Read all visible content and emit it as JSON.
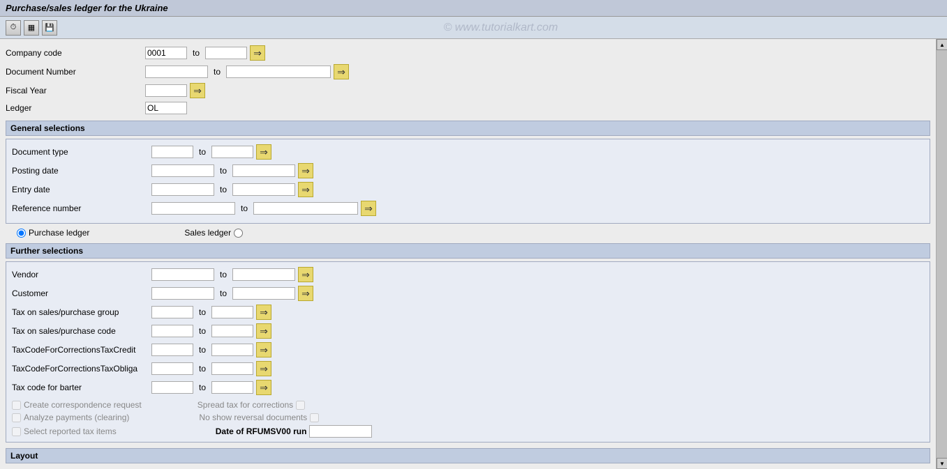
{
  "title": "Purchase/sales ledger for the Ukraine",
  "watermark": "© www.tutorialkart.com",
  "toolbar": {
    "icons": [
      "⏱",
      "▦",
      "💾"
    ]
  },
  "fields": {
    "company_code": {
      "label": "Company code",
      "value": "0001",
      "value2": ""
    },
    "document_number": {
      "label": "Document Number",
      "value": "",
      "value2": ""
    },
    "fiscal_year": {
      "label": "Fiscal Year",
      "value": ""
    },
    "ledger": {
      "label": "Ledger",
      "value": "OL"
    },
    "to_label": "to"
  },
  "general_selections": {
    "title": "General selections",
    "document_type": {
      "label": "Document type",
      "value": "",
      "value2": ""
    },
    "posting_date": {
      "label": "Posting date",
      "value": "",
      "value2": ""
    },
    "entry_date": {
      "label": "Entry date",
      "value": "",
      "value2": ""
    },
    "reference_number": {
      "label": "Reference number",
      "value": "",
      "value2": ""
    }
  },
  "ledger_selection": {
    "purchase_ledger": "Purchase ledger",
    "sales_ledger": "Sales ledger"
  },
  "further_selections": {
    "title": "Further selections",
    "vendor": {
      "label": "Vendor",
      "value": "",
      "value2": ""
    },
    "customer": {
      "label": "Customer",
      "value": "",
      "value2": ""
    },
    "tax_group": {
      "label": "Tax on sales/purchase group",
      "value": "",
      "value2": ""
    },
    "tax_code": {
      "label": "Tax on sales/purchase code",
      "value": "",
      "value2": ""
    },
    "tax_credit": {
      "label": "TaxCodeForCorrectionsTaxCredit",
      "value": "",
      "value2": ""
    },
    "tax_obliga": {
      "label": "TaxCodeForCorrectionsTaxObliga",
      "value": "",
      "value2": ""
    },
    "tax_barter": {
      "label": "Tax code for barter",
      "value": "",
      "value2": ""
    }
  },
  "checkboxes": {
    "create_correspondence": "Create correspondence request",
    "analyze_payments": "Analyze payments (clearing)",
    "select_reported": "Select reported tax items",
    "spread_tax": "Spread tax for corrections",
    "no_show_reversal": "No show reversal documents",
    "date_rfumsv": "Date of RFUMSV00 run"
  },
  "layout": {
    "title": "Layout"
  },
  "buttons": {
    "arrow": "⇒"
  }
}
